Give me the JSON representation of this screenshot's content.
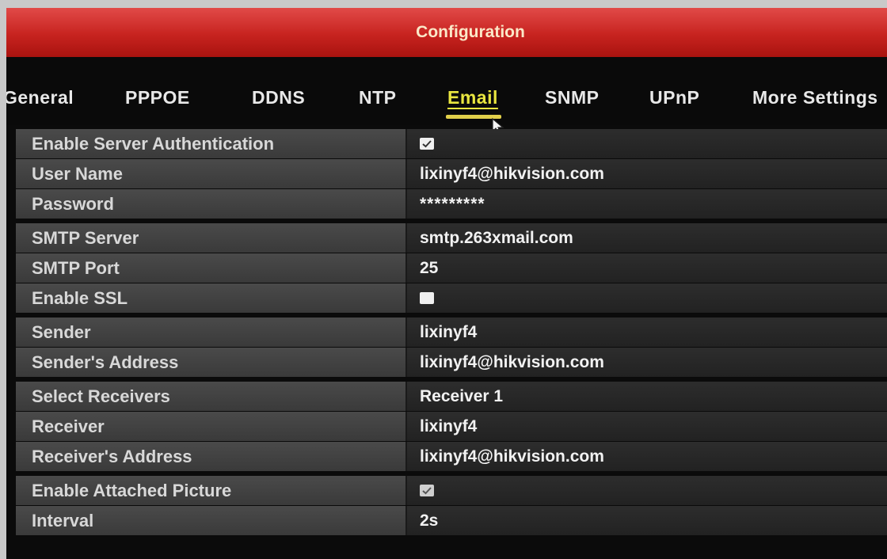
{
  "window": {
    "title": "Configuration"
  },
  "tabs": [
    {
      "label": "General"
    },
    {
      "label": "PPPOE"
    },
    {
      "label": "DDNS"
    },
    {
      "label": "NTP"
    },
    {
      "label": "Email"
    },
    {
      "label": "SNMP"
    },
    {
      "label": "UPnP"
    },
    {
      "label": "More Settings"
    }
  ],
  "active_tab": "Email",
  "form": {
    "enable_auth": {
      "label": "Enable Server Authentication",
      "checked": true
    },
    "user_name": {
      "label": "User Name",
      "value": "lixinyf4@hikvision.com"
    },
    "password": {
      "label": "Password",
      "value": "*********"
    },
    "smtp_server": {
      "label": "SMTP Server",
      "value": "smtp.263xmail.com"
    },
    "smtp_port": {
      "label": "SMTP Port",
      "value": "25"
    },
    "enable_ssl": {
      "label": "Enable SSL",
      "checked": false
    },
    "sender": {
      "label": "Sender",
      "value": "lixinyf4"
    },
    "sender_address": {
      "label": "Sender's Address",
      "value": "lixinyf4@hikvision.com"
    },
    "select_receivers": {
      "label": "Select Receivers",
      "value": "Receiver 1"
    },
    "receiver": {
      "label": "Receiver",
      "value": "lixinyf4"
    },
    "receiver_address": {
      "label": "Receiver's Address",
      "value": "lixinyf4@hikvision.com"
    },
    "enable_attached_picture": {
      "label": "Enable Attached Picture",
      "checked": true
    },
    "interval": {
      "label": "Interval",
      "value": "2s"
    }
  },
  "colors": {
    "titlebar": "#c7231f",
    "active_tab": "#e9e640"
  }
}
